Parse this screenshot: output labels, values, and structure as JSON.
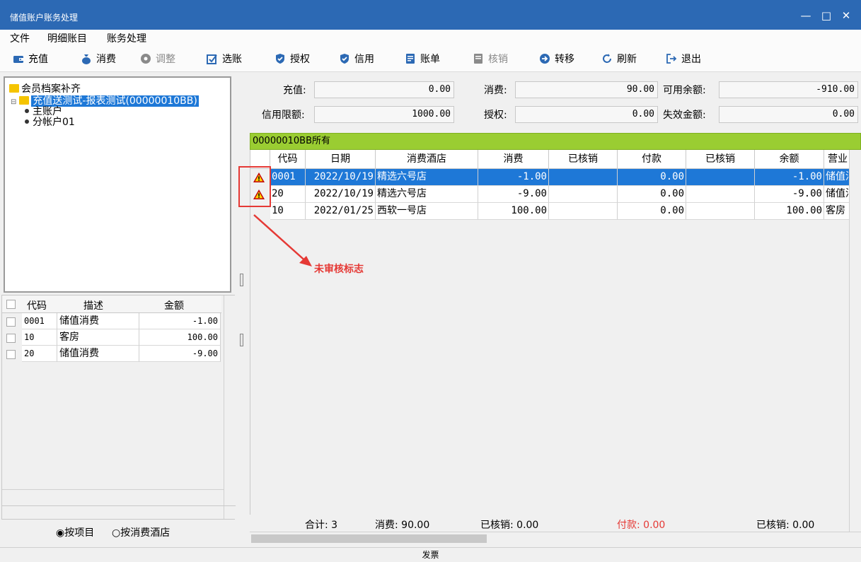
{
  "window": {
    "title": "储值账户账务处理",
    "controls": {
      "minimize": "—",
      "maximize": "□",
      "close": "✕"
    }
  },
  "menu": [
    "文件",
    "明细账目",
    "账务处理"
  ],
  "toolbar": [
    {
      "label": "充值",
      "icon": "wallet-icon",
      "enabled": true
    },
    {
      "label": "消费",
      "icon": "money-bag-icon",
      "enabled": true
    },
    {
      "label": "调整",
      "icon": "adjust-icon",
      "enabled": false
    },
    {
      "label": "选账",
      "icon": "select-account-icon",
      "enabled": true
    },
    {
      "label": "授权",
      "icon": "shield-check-icon",
      "enabled": true
    },
    {
      "label": "信用",
      "icon": "shield-check-icon",
      "enabled": true
    },
    {
      "label": "账单",
      "icon": "bill-icon",
      "enabled": true
    },
    {
      "label": "核销",
      "icon": "verify-icon",
      "enabled": false
    },
    {
      "label": "转移",
      "icon": "arrow-right-icon",
      "enabled": true
    },
    {
      "label": "刷新",
      "icon": "refresh-icon",
      "enabled": true
    },
    {
      "label": "退出",
      "icon": "exit-icon",
      "enabled": true
    }
  ],
  "tree": {
    "root": "会员档案补齐",
    "account": "充值送测试-报表测试(00000010BB)",
    "children": [
      "主账户",
      "分帐户01"
    ]
  },
  "left_grid": {
    "headers": [
      "代码",
      "描述",
      "金额"
    ],
    "rows": [
      {
        "code": "0001",
        "desc": "储值消费",
        "amount": "-1.00"
      },
      {
        "code": "10",
        "desc": "客房",
        "amount": "100.00"
      },
      {
        "code": "20",
        "desc": "储值消费",
        "amount": "-9.00"
      }
    ]
  },
  "grouping": {
    "options": [
      "按项目",
      "按消费酒店"
    ],
    "selected": "按项目"
  },
  "summary": {
    "recharge_label": "充值:",
    "recharge": "0.00",
    "consume_label": "消费:",
    "consume": "90.00",
    "available_label": "可用余额:",
    "available": "-910.00",
    "credit_label": "信用限额:",
    "credit": "1000.00",
    "auth_label": "授权:",
    "auth": "0.00",
    "expired_label": "失效金额:",
    "expired": "0.00"
  },
  "owner_bar": "00000010BB所有",
  "main_grid": {
    "headers": [
      "代码",
      "日期",
      "消费酒店",
      "消费",
      "已核销",
      "付款",
      "已核销",
      "余额",
      "营业"
    ],
    "rows": [
      {
        "warn": true,
        "selected": true,
        "code": "0001",
        "date": "2022/10/19",
        "hotel": "精选六号店",
        "consume": "-1.00",
        "verified1": "",
        "payment": "0.00",
        "verified2": "",
        "balance": "-1.00",
        "type": "储值消"
      },
      {
        "warn": true,
        "selected": false,
        "code": "20",
        "date": "2022/10/19",
        "hotel": "精选六号店",
        "consume": "-9.00",
        "verified1": "",
        "payment": "0.00",
        "verified2": "",
        "balance": "-9.00",
        "type": "储值消"
      },
      {
        "warn": false,
        "selected": false,
        "code": "10",
        "date": "2022/01/25",
        "hotel": "西软一号店",
        "consume": "100.00",
        "verified1": "",
        "payment": "0.00",
        "verified2": "",
        "balance": "100.00",
        "type": "客房"
      }
    ]
  },
  "footer": {
    "count": "合计: 3",
    "consume": "消费: 90.00",
    "verified1": "已核销: 0.00",
    "payment": "付款: 0.00",
    "verified2": "已核销: 0.00"
  },
  "annotation": "未审核标志",
  "statusbar": "发票",
  "colors": {
    "titlebar": "#2c69b4",
    "selected_row": "#1e78d7",
    "owner_bar": "#9acd32",
    "annotation": "#e53935",
    "payment_text": "#e53935"
  }
}
